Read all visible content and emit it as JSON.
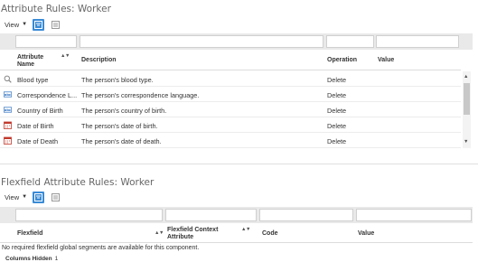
{
  "attribute_rules": {
    "title": "Attribute Rules: Worker",
    "view_label": "View",
    "columns": {
      "attribute_name": "Attribute Name",
      "description": "Description",
      "operation": "Operation",
      "value": "Value"
    },
    "rows": [
      {
        "icon": "search-icon",
        "name": "Blood type",
        "description": "The person's blood type.",
        "operation": "Delete",
        "value": ""
      },
      {
        "icon": "string-icon",
        "name": "Correspondence L...",
        "description": "The person's correspondence language.",
        "operation": "Delete",
        "value": ""
      },
      {
        "icon": "string-icon",
        "name": "Country of Birth",
        "description": "The person's country of birth.",
        "operation": "Delete",
        "value": ""
      },
      {
        "icon": "calendar-icon",
        "name": "Date of Birth",
        "description": "The person's date of birth.",
        "operation": "Delete",
        "value": ""
      },
      {
        "icon": "calendar-icon",
        "name": "Date of Death",
        "description": "The person's date of death.",
        "operation": "Delete",
        "value": ""
      }
    ]
  },
  "flexfield_rules": {
    "title": "Flexfield Attribute Rules: Worker",
    "view_label": "View",
    "columns": {
      "flexfield": "Flexfield",
      "context_attribute": "Flexfield Context Attribute",
      "code": "Code",
      "value": "Value"
    },
    "empty_message": "No required flexfield global segments are available for this component.",
    "columns_hidden_label": "Columns Hidden",
    "columns_hidden_count": "1"
  },
  "colors": {
    "accent": "#3a8bd6",
    "filter_bar": "#e9e9e9",
    "calendar_icon": "#c0392b",
    "string_icon": "#2c6fbf"
  }
}
